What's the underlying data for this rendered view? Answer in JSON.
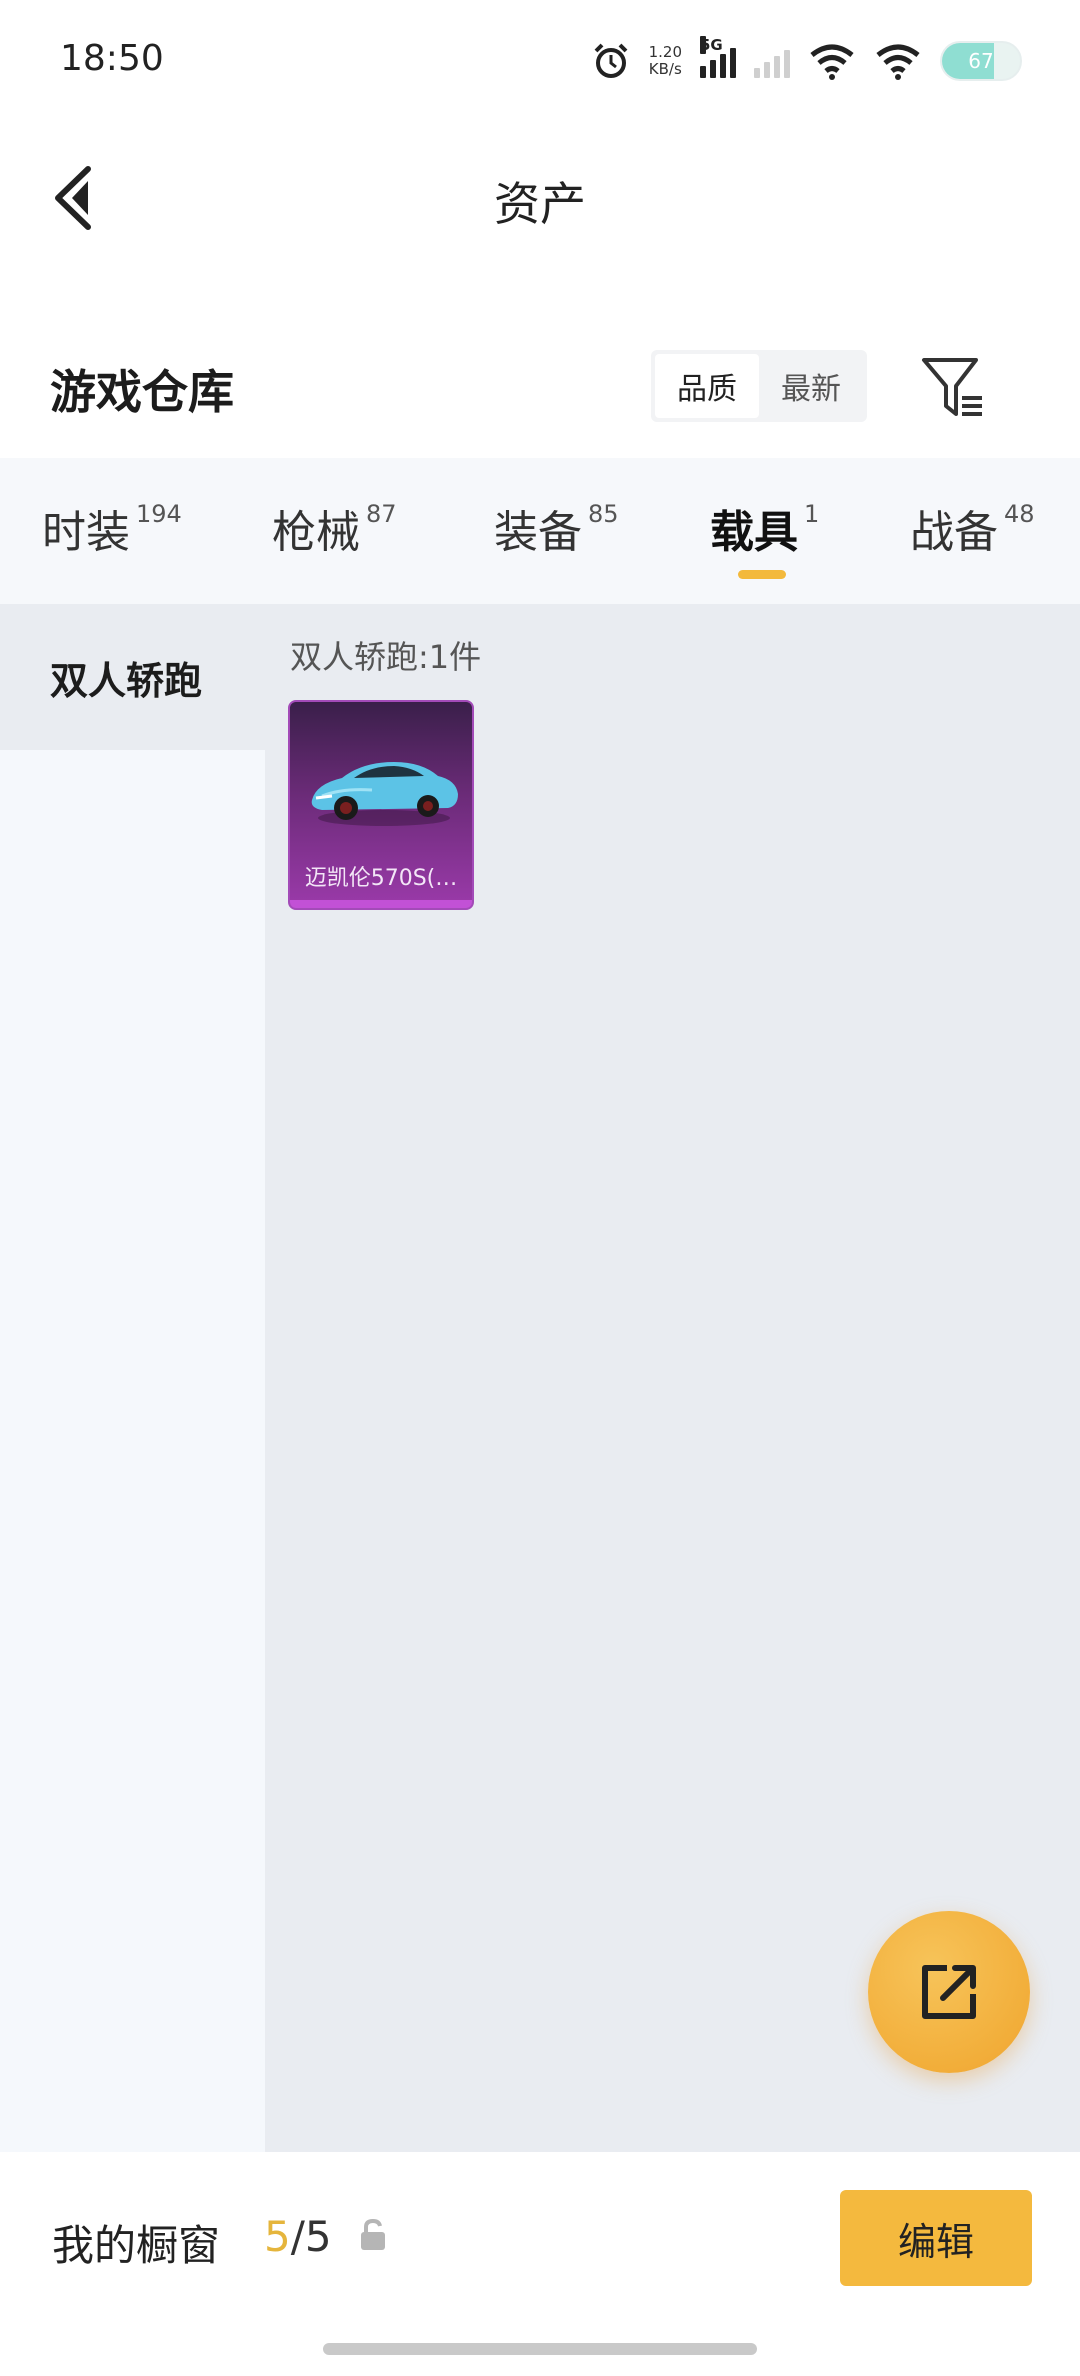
{
  "status_bar": {
    "time": "18:50",
    "net_speed_value": "1.20",
    "net_speed_unit": "KB/s",
    "network_type": "5G",
    "battery": "67"
  },
  "header": {
    "title": "资产"
  },
  "warehouse": {
    "title": "游戏仓库",
    "sort_options": [
      "品质",
      "最新"
    ],
    "active_sort": "品质"
  },
  "tabs": [
    {
      "label": "时装",
      "count": "194"
    },
    {
      "label": "枪械",
      "count": "87"
    },
    {
      "label": "装备",
      "count": "85"
    },
    {
      "label": "载具",
      "count": "1",
      "active": true
    },
    {
      "label": "战备",
      "count": "48"
    }
  ],
  "sidebar": {
    "items": [
      {
        "label": "双人轿跑",
        "active": true
      }
    ]
  },
  "group": {
    "header": "双人轿跑:1件",
    "items": [
      {
        "name": "迈凯伦570S(…",
        "icon": "car-icon",
        "rarity_color": "#9b3aaa"
      }
    ]
  },
  "bottom_bar": {
    "showcase_label": "我的橱窗",
    "showcase_current": "5",
    "showcase_total": "/5",
    "edit_label": "编辑"
  },
  "colors": {
    "accent": "#f4b93e",
    "tab_indicator": "#f3b93c",
    "rarity_purple": "#9b3aaa"
  }
}
